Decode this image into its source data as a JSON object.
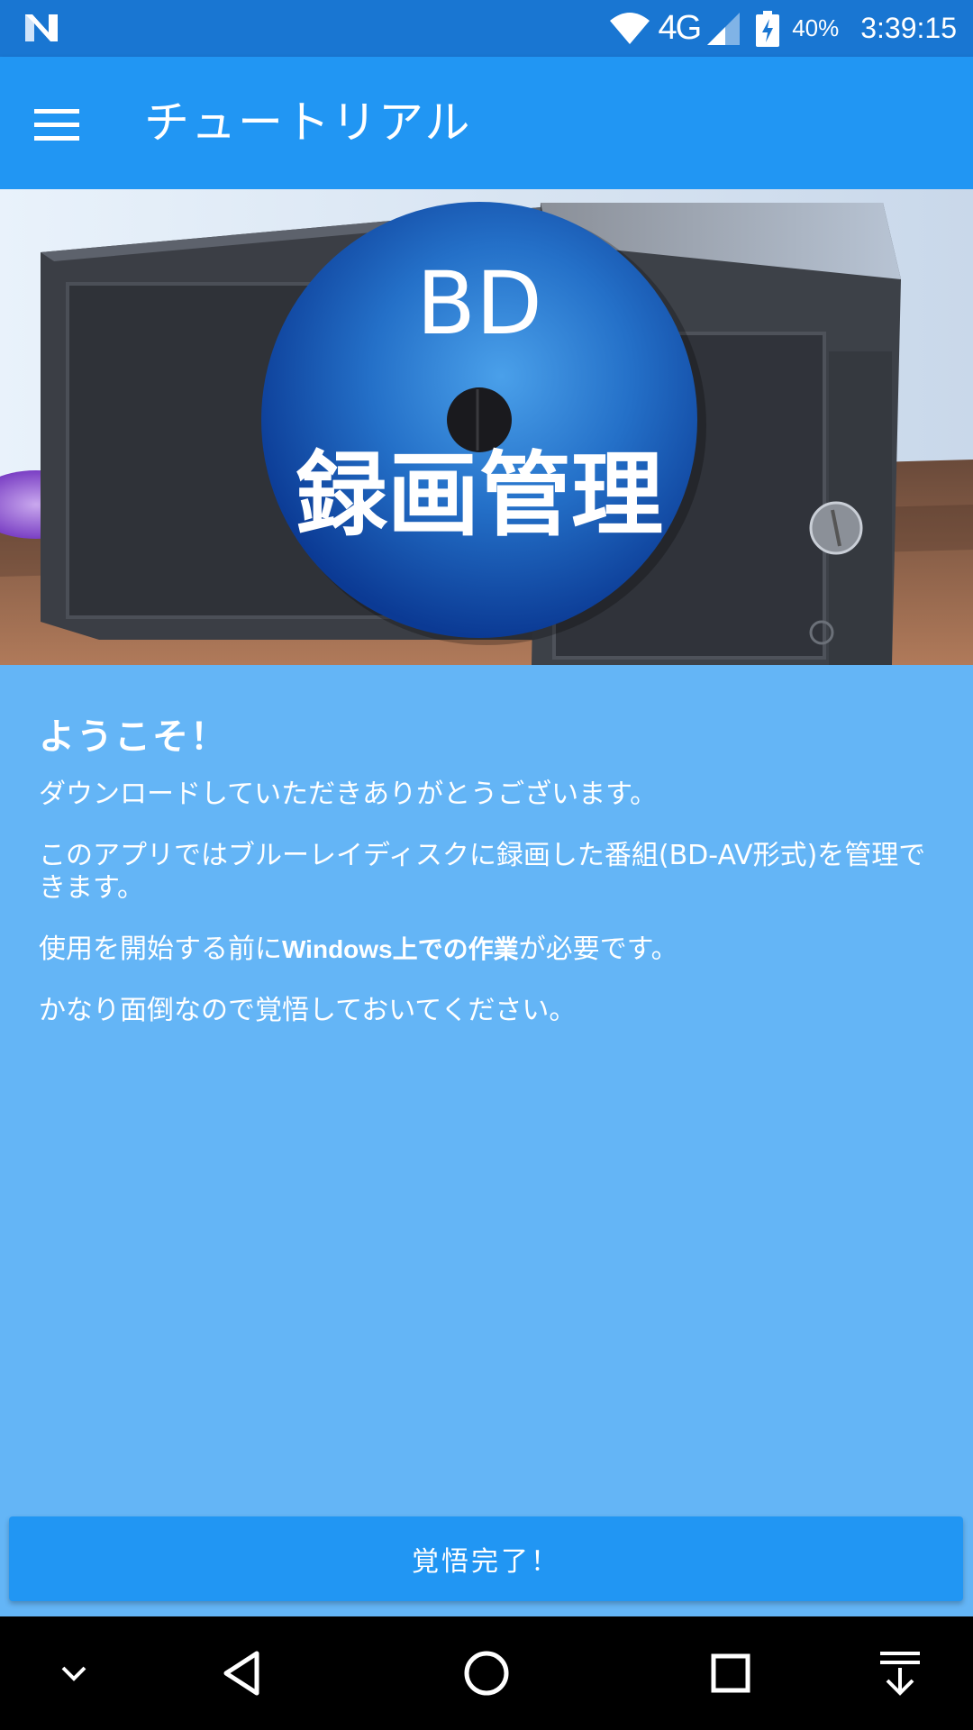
{
  "status_bar": {
    "network": "4G",
    "battery_percent": "40%",
    "time": "3:39:15",
    "icons": [
      "n-logo-icon",
      "wifi-icon",
      "signal-icon",
      "battery-charging-icon"
    ]
  },
  "app_bar": {
    "title": "チュートリアル",
    "menu_icon": "hamburger-menu-icon"
  },
  "hero": {
    "disc_line1": "BD",
    "disc_line2": "録画管理",
    "colors": {
      "disc_outer": "#0a3e9c",
      "disc_inner": "#3a8fe0"
    }
  },
  "content": {
    "welcome": "ようこそ！",
    "para1": "ダウンロードしていただきありがとうございます。",
    "para2": "このアプリではブルーレイディスクに録画した番組(BD-AV形式)を管理できます。",
    "para3_before": "使用を開始する前に",
    "para3_bold": "Windows上での作業",
    "para3_after": "が必要です。",
    "para4": "かなり面倒なので覚悟しておいてください。"
  },
  "actions": {
    "complete_label": "覚悟完了！"
  },
  "nav_bar": {
    "icons": [
      "chevron-down-icon",
      "back-icon",
      "home-icon",
      "recents-icon",
      "download-icon"
    ]
  },
  "colors": {
    "status_bar": "#1976d2",
    "app_bar": "#2196f3",
    "background": "#64b5f6",
    "button": "#2196f3"
  }
}
